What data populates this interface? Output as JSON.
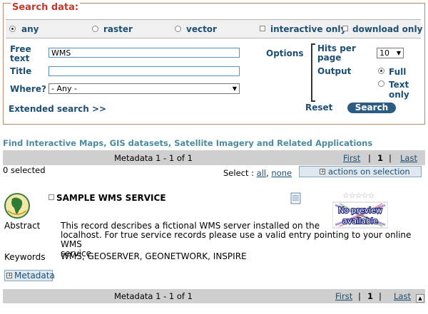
{
  "search": {
    "legend": "Search data:",
    "types": [
      {
        "label": "any",
        "selected": true
      },
      {
        "label": "raster",
        "selected": false
      },
      {
        "label": "vector",
        "selected": false
      }
    ],
    "interactive_only": "interactive only",
    "download_only": "download only",
    "free_text_label": "Free\ntext",
    "free_text_value": "WMS",
    "title_label": "Title",
    "title_value": "",
    "where_label": "Where?",
    "where_value": "- Any -",
    "options_label": "Options",
    "hits_label": "Hits per\npage",
    "hits_value": "10",
    "output_label": "Output",
    "output_full": "Full",
    "output_text": "Text\nonly",
    "extended_search": "Extended search >>",
    "reset": "Reset",
    "search_button": "Search"
  },
  "results": {
    "heading": "Find Interactive Maps, GIS datasets, Satellite Imagery and Related Applications",
    "metadata_range": "Metadata 1 - 1 of 1",
    "first": "First",
    "sep": "|",
    "page": "1",
    "last": "Last",
    "selected_count": "0 selected",
    "select_label": "Select :",
    "select_all": "all",
    "select_comma": ",",
    "select_none": "none",
    "actions": "actions on selection",
    "record": {
      "title": "SAMPLE WMS SERVICE",
      "preview_text": "No preview\navailable",
      "abstract_label": "Abstract",
      "abstract_lines": [
        "This record describes a fictional WMS server installed on the",
        "localhost. For true service records please use a valid entry pointing to your online WMS",
        "service"
      ],
      "keywords_label": "Keywords",
      "keywords": "WMS, GEOSERVER, GEONETWORK, INSPIRE",
      "metadata_button": "Metadata"
    }
  },
  "colors": {
    "legend": "#c0392b",
    "label_blue": "#1c4f75",
    "heading_teal": "#4a8c9d",
    "search_button": "#2c5c82",
    "bar_gray": "#cfcfcf"
  }
}
